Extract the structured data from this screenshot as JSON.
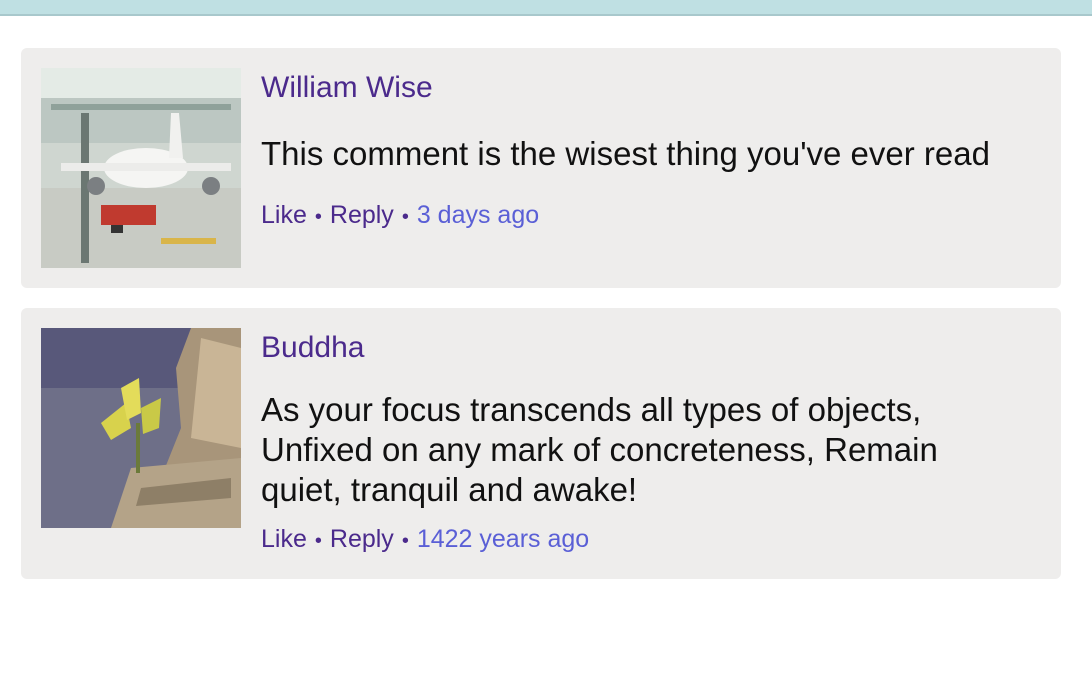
{
  "comments": [
    {
      "author": "William Wise",
      "text": "This comment is the wisest thing you've ever read",
      "like_label": "Like",
      "reply_label": "Reply",
      "timestamp": "3 days ago",
      "avatar_icon": "airplane-photo"
    },
    {
      "author": "Buddha",
      "text": "As your focus transcends all types of objects, Unfixed on any mark of concreteness, Remain quiet, tranquil and awake!",
      "like_label": "Like",
      "reply_label": "Reply",
      "timestamp": "1422 years ago",
      "avatar_icon": "plant-on-rock-photo"
    }
  ],
  "separator": "•",
  "colors": {
    "top_bar": "#bfe0e3",
    "card_bg": "#eeedec",
    "author": "#4b2a8c",
    "timestamp": "#5a5fd6"
  }
}
